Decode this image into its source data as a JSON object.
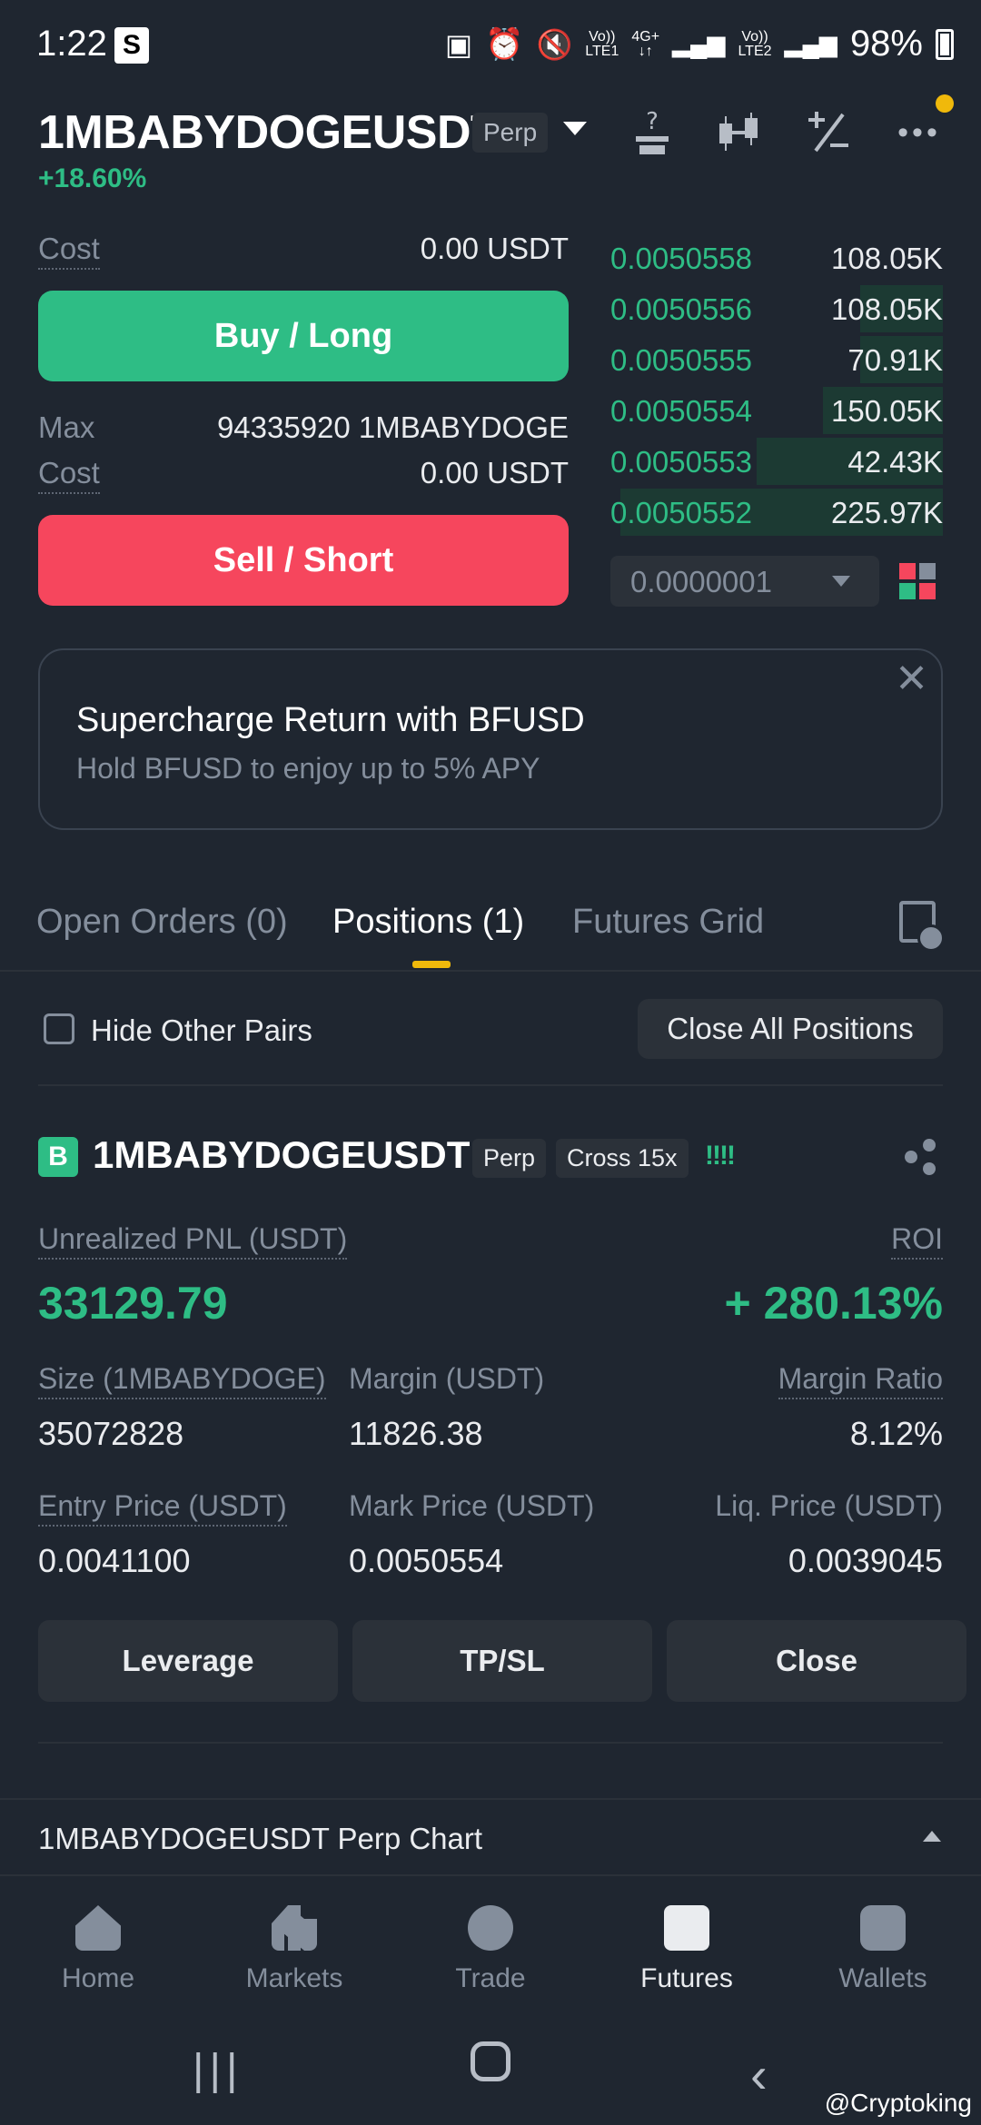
{
  "status_bar": {
    "time": "1:22",
    "s_badge": "S",
    "net1_top": "Vo))",
    "net1_bottom": "LTE1",
    "net2_top": "4G+",
    "net2_bottom": "↓↑",
    "net3_top": "Vo))",
    "net3_bottom": "LTE2",
    "battery": "98%"
  },
  "header": {
    "symbol": "1MBABYDOGEUSDT",
    "type_tag": "Perp",
    "change": "+18.60%"
  },
  "trade_panel": {
    "cost_label": "Cost",
    "cost_value_buy": "0.00 USDT",
    "buy_label": "Buy / Long",
    "max_label": "Max",
    "max_value": "94335920 1MBABYDOGE",
    "cost_value_sell": "0.00 USDT",
    "sell_label": "Sell / Short"
  },
  "order_book": {
    "bids": [
      {
        "price": "0.0050558",
        "qty": "108.05K",
        "depth": 0.0
      },
      {
        "price": "0.0050556",
        "qty": "108.05K",
        "depth": 0.25
      },
      {
        "price": "0.0050555",
        "qty": "70.91K",
        "depth": 0.25
      },
      {
        "price": "0.0050554",
        "qty": "150.05K",
        "depth": 0.36
      },
      {
        "price": "0.0050553",
        "qty": "42.43K",
        "depth": 0.56
      },
      {
        "price": "0.0050552",
        "qty": "225.97K",
        "depth": 0.97
      }
    ],
    "tick_size": "0.0000001"
  },
  "promo": {
    "title": "Supercharge Return with BFUSD",
    "subtitle": "Hold BFUSD to enjoy up to 5% APY",
    "close_glyph": "✕"
  },
  "tabs": [
    {
      "label": "Open Orders (0)"
    },
    {
      "label": "Positions (1)"
    },
    {
      "label": "Futures Grid"
    }
  ],
  "filters": {
    "hide_other_pairs": "Hide Other Pairs",
    "close_all": "Close All Positions"
  },
  "position": {
    "side_badge": "B",
    "symbol": "1MBABYDOGEUSDT",
    "type_tag": "Perp",
    "margin_mode": "Cross 15x",
    "strength_glyph": "!!!!",
    "pnl_label": "Unrealized PNL (USDT)",
    "pnl_value": "33129.79",
    "roi_label": "ROI",
    "roi_value": "+ 280.13%",
    "size_label": "Size (1MBABYDOGE)",
    "size_value": "35072828",
    "margin_label": "Margin (USDT)",
    "margin_value": "11826.38",
    "margin_ratio_label": "Margin Ratio",
    "margin_ratio_value": "8.12%",
    "entry_label": "Entry Price (USDT)",
    "entry_value": "0.0041100",
    "mark_label": "Mark Price (USDT)",
    "mark_value": "0.0050554",
    "liq_label": "Liq. Price (USDT)",
    "liq_value": "0.0039045",
    "actions": {
      "leverage": "Leverage",
      "tpsl": "TP/SL",
      "close": "Close"
    }
  },
  "chart_bar": {
    "label": "1MBABYDOGEUSDT Perp Chart"
  },
  "bottom_nav": [
    {
      "label": "Home",
      "icon": "home-icon"
    },
    {
      "label": "Markets",
      "icon": "markets-icon"
    },
    {
      "label": "Trade",
      "icon": "trade-icon"
    },
    {
      "label": "Futures",
      "icon": "futures-icon"
    },
    {
      "label": "Wallets",
      "icon": "wallets-icon"
    }
  ],
  "watermark": "@Cryptoking",
  "colors": {
    "green": "#2ebd85",
    "red": "#f6465d",
    "accent": "#f0b90b",
    "bg": "#1f2630"
  }
}
